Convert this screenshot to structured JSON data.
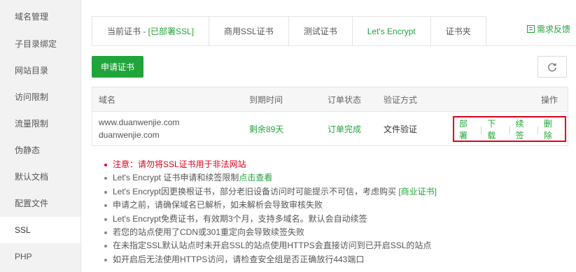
{
  "sidebar": {
    "items": [
      {
        "label": "域名管理",
        "active": false
      },
      {
        "label": "子目录绑定",
        "active": false
      },
      {
        "label": "网站目录",
        "active": false
      },
      {
        "label": "访问限制",
        "active": false
      },
      {
        "label": "流量限制",
        "active": false
      },
      {
        "label": "伪静态",
        "active": false
      },
      {
        "label": "默认文档",
        "active": false
      },
      {
        "label": "配置文件",
        "active": false
      },
      {
        "label": "SSL",
        "active": true
      },
      {
        "label": "PHP",
        "active": false
      }
    ]
  },
  "tabs": {
    "current_cert_prefix": "当前证书 - ",
    "current_cert_status": "[已部署SSL]",
    "commercial": "商用SSL证书",
    "test": "测试证书",
    "letsencrypt": "Let's Encrypt",
    "folder": "证书夹",
    "active": "Let's Encrypt"
  },
  "feedback": {
    "label": "需求反馈",
    "icon": "feedback-icon"
  },
  "toolbar": {
    "apply_label": "申请证书",
    "refresh_icon": "refresh-icon"
  },
  "table": {
    "headers": {
      "domain": "域名",
      "expire": "到期时间",
      "status": "订单状态",
      "verify": "验证方式",
      "ops": "操作"
    },
    "rows": [
      {
        "domains": [
          "www.duanwenjie.com",
          "duanwenjie.com"
        ],
        "expire": "剩余89天",
        "status": "订单完成",
        "verify": "文件验证",
        "ops": [
          "部署",
          "下载",
          "续签",
          "删除"
        ]
      }
    ]
  },
  "notes": {
    "warn": "注意：请勿将SSL证书用于非法网站",
    "n1_text": "Let's Encrypt 证书申请和续签限制",
    "n1_link": "点击查看",
    "n2_text": "Let's Encrypt因更换根证书，部分老旧设备访问时可能提示不可信，考虑购买 ",
    "n2_link": "[商业证书]",
    "n3": "申请之前，请确保域名已解析，如未解析会导致审核失败",
    "n4": "Let's Encrypt免费证书，有效期3个月，支持多域名。默认会自动续签",
    "n5": "若您的站点使用了CDN或301重定向会导致续签失败",
    "n6": "在未指定SSL默认站点时未开启SSL的站点使用HTTPS会直接访问到已开启SSL的站点",
    "n7": "如开启后无法使用HTTPS访问，请检查安全组是否正确放行443端口"
  },
  "colors": {
    "accent": "#20a53a",
    "danger": "#e0001b"
  }
}
